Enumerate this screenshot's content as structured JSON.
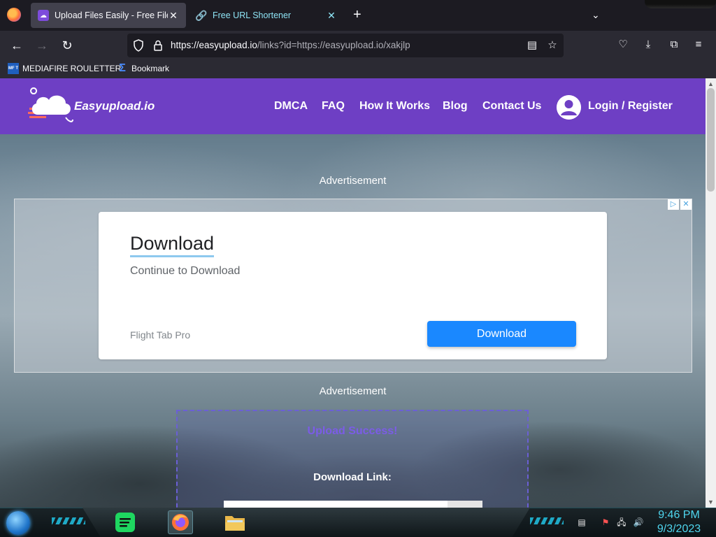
{
  "browser": {
    "tabs": [
      {
        "title": "Upload Files Easily - Free File Up",
        "active": true,
        "icon": "easyupload-favicon"
      },
      {
        "title": "Free URL Shortener",
        "active": false,
        "icon": "link-icon"
      }
    ],
    "new_tab_label": "+",
    "url": {
      "host": "https://easyupload.io",
      "path": "/links?id=https://easyupload.io/xakjlp"
    },
    "bookmarks": [
      {
        "label": "MEDIAFIRE ROULETTER",
        "icon_text": "MF T"
      },
      {
        "label": "Bookmark",
        "icon": "sigma-icon"
      }
    ]
  },
  "site": {
    "logo_text": "Easyupload.io",
    "nav": [
      "DMCA",
      "FAQ",
      "How It Works",
      "Blog",
      "Contact Us"
    ],
    "login_label": "Login / Register",
    "brand_color": "#6e3fc4"
  },
  "ads": {
    "label_top": "Advertisement",
    "label_bottom": "Advertisement",
    "card": {
      "title": "Download",
      "subtitle": "Continue to Download",
      "brand": "Flight Tab Pro",
      "button": "Download"
    }
  },
  "upload": {
    "success": "Upload Success!",
    "download_link_label": "Download Link:"
  },
  "taskbar": {
    "time": "9:46 PM",
    "date": "9/3/2023"
  }
}
